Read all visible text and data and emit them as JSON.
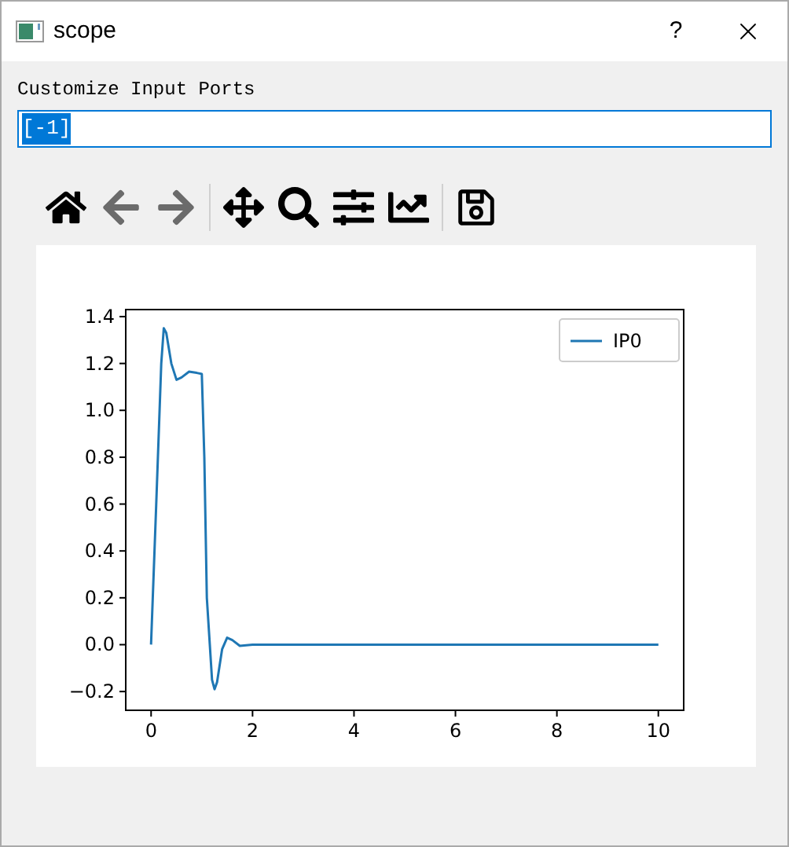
{
  "window": {
    "title": "scope",
    "help": "?"
  },
  "ports": {
    "label": "Customize Input Ports",
    "value": "[-1]",
    "selected": true
  },
  "toolbar": [
    {
      "kind": "home",
      "disabled": false
    },
    {
      "kind": "back",
      "disabled": true
    },
    {
      "kind": "forward",
      "disabled": true
    },
    {
      "kind": "separator"
    },
    {
      "kind": "pan",
      "disabled": false
    },
    {
      "kind": "zoom",
      "disabled": false
    },
    {
      "kind": "subplots",
      "disabled": false
    },
    {
      "kind": "axes",
      "disabled": false
    },
    {
      "kind": "separator"
    },
    {
      "kind": "save",
      "disabled": false
    }
  ],
  "plot": {
    "chart_data": {
      "type": "line",
      "x": [
        0,
        0.1,
        0.2,
        0.25,
        0.3,
        0.4,
        0.5,
        0.6,
        0.75,
        0.9,
        1.0,
        1.05,
        1.1,
        1.2,
        1.25,
        1.3,
        1.4,
        1.5,
        1.6,
        1.75,
        2,
        10
      ],
      "series": [
        {
          "name": "IP0",
          "color": "#1f77b4",
          "values": [
            0,
            0.6,
            1.2,
            1.35,
            1.33,
            1.2,
            1.13,
            1.14,
            1.165,
            1.16,
            1.155,
            0.8,
            0.2,
            -0.15,
            -0.19,
            -0.16,
            -0.02,
            0.03,
            0.02,
            -0.005,
            0,
            0
          ]
        }
      ],
      "xlim": [
        -0.5,
        10.5
      ],
      "ylim": [
        -0.28,
        1.43
      ],
      "xticks": [
        0,
        2,
        4,
        6,
        8,
        10
      ],
      "yticks": [
        {
          "value": -0.2,
          "label": "−0.2"
        },
        {
          "value": 0,
          "label": "0.0"
        },
        {
          "value": 0.2,
          "label": "0.2"
        },
        {
          "value": 0.4,
          "label": "0.4"
        },
        {
          "value": 0.6,
          "label": "0.6"
        },
        {
          "value": 0.8,
          "label": "0.8"
        },
        {
          "value": 1.0,
          "label": "1.0"
        },
        {
          "value": 1.2,
          "label": "1.2"
        },
        {
          "value": 1.4,
          "label": "1.4"
        }
      ]
    }
  }
}
